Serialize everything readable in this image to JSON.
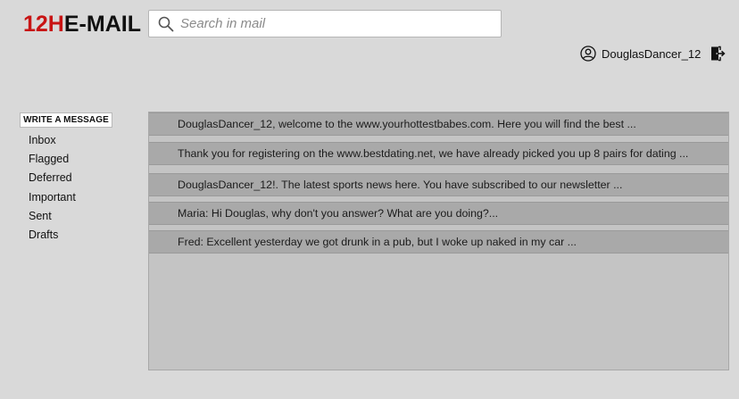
{
  "logo": {
    "part_red": "12H",
    "part_black": "E-MAIL"
  },
  "search": {
    "placeholder": "Search in mail",
    "value": ""
  },
  "user": {
    "username": "DouglasDancer_12"
  },
  "sidebar": {
    "write_label": "WRITE A MESSAGE",
    "items": [
      {
        "label": "Inbox"
      },
      {
        "label": "Flagged"
      },
      {
        "label": "Deferred"
      },
      {
        "label": "Important"
      },
      {
        "label": "Sent"
      },
      {
        "label": "Drafts"
      }
    ]
  },
  "mails": [
    {
      "preview": "DouglasDancer_12, welcome to the www.yourhottestbabes.com. Here you will find the best ..."
    },
    {
      "preview": "Thank you for registering on the www.bestdating.net, we have already picked you up 8 pairs for dating ..."
    },
    {
      "preview": "DouglasDancer_12!. The latest sports news here. You have subscribed to our newsletter ..."
    },
    {
      "preview": "Maria: Hi Douglas, why don't you answer? What are you doing?..."
    },
    {
      "preview": "Fred: Excellent yesterday we got drunk in a pub, but I woke up naked in my car ..."
    }
  ],
  "colors": {
    "logo_red": "#c81414",
    "background": "#d9d9d9",
    "mail_row": "#a9a9a9",
    "panel": "#c4c4c4"
  },
  "icons": [
    "search-icon",
    "user-icon",
    "logout-icon"
  ]
}
